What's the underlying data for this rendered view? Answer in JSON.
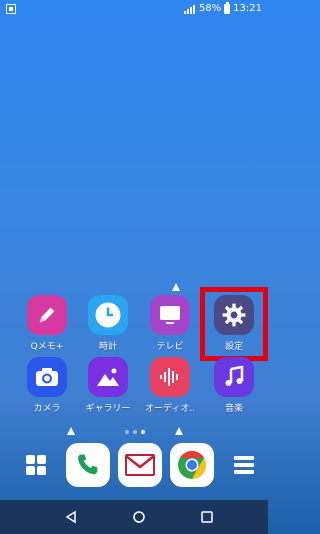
{
  "status_bar": {
    "battery_percent": "58%",
    "time": "13:21"
  },
  "apps": [
    {
      "id": "qmemo",
      "label": "Qメモ+",
      "color": "#d6399f",
      "icon_name": "pencil-icon"
    },
    {
      "id": "clock",
      "label": "時計",
      "color": "#2aa6f0",
      "icon_name": "clock-icon"
    },
    {
      "id": "tv",
      "label": "テレビ",
      "color": "#a346c9",
      "icon_name": "tv-icon"
    },
    {
      "id": "settings",
      "label": "設定",
      "color": "#4b4a86",
      "icon_name": "gear-icon"
    },
    {
      "id": "camera",
      "label": "カメラ",
      "color": "#2a57ea",
      "icon_name": "camera-icon"
    },
    {
      "id": "gallery",
      "label": "ギャラリー",
      "color": "#7a2fe0",
      "icon_name": "gallery-icon"
    },
    {
      "id": "audio",
      "label": "オーディオ..",
      "color": "#e84060",
      "icon_name": "audio-wave-icon"
    },
    {
      "id": "music",
      "label": "音楽",
      "color": "#6a38e0",
      "icon_name": "music-note-icon"
    }
  ],
  "highlighted_app": "settings",
  "page_indicator": {
    "count": 3,
    "active": 2
  },
  "dock": [
    {
      "id": "app-drawer",
      "icon_name": "app-grid-icon"
    },
    {
      "id": "phone",
      "icon_name": "phone-icon"
    },
    {
      "id": "mail",
      "icon_name": "mail-icon"
    },
    {
      "id": "chrome",
      "icon_name": "chrome-icon"
    },
    {
      "id": "menu",
      "icon_name": "menu-icon"
    }
  ],
  "nav_bar": [
    {
      "id": "back",
      "icon_name": "back-icon"
    },
    {
      "id": "home",
      "icon_name": "home-icon"
    },
    {
      "id": "recents",
      "icon_name": "recents-icon"
    }
  ],
  "colors": {
    "highlight": "#e0000f",
    "nav_bar": "#1a365e"
  }
}
